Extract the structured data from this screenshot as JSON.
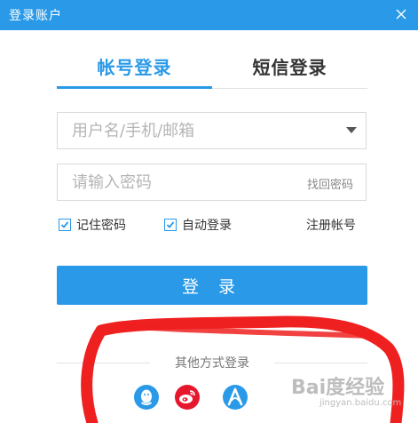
{
  "window": {
    "title": "登录账户",
    "close_icon": "close-icon"
  },
  "tabs": [
    {
      "label": "帐号登录",
      "active": true
    },
    {
      "label": "短信登录",
      "active": false
    }
  ],
  "username": {
    "placeholder": "用户名/手机/邮箱",
    "value": ""
  },
  "password": {
    "placeholder": "请输入密码",
    "value": "",
    "forgot_label": "找回密码"
  },
  "options": {
    "remember": {
      "label": "记住密码",
      "checked": true
    },
    "auto_login": {
      "label": "自动登录",
      "checked": true
    },
    "register_label": "注册帐号"
  },
  "login_button": "登 录",
  "other_login": {
    "label": "其他方式登录",
    "providers": [
      "qq-icon",
      "weibo-icon",
      "baidu-icon"
    ]
  },
  "watermark": {
    "brand": "Bai度经验",
    "url": "jingyan.baidu.com"
  },
  "colors": {
    "accent": "#2a9ae8",
    "annotation": "#ef2020",
    "weibo": "#e6162d"
  }
}
